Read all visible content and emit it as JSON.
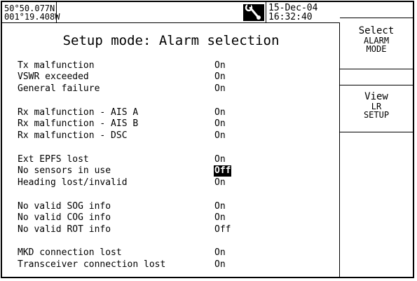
{
  "header": {
    "latitude": "50°50.077N",
    "longitude": "001°19.408W",
    "date": "15-Dec-04",
    "time": "16:32:40",
    "status_icon": "wrench-icon"
  },
  "page": {
    "title": "Setup mode: Alarm selection"
  },
  "alarms": [
    {
      "label": "Tx malfunction",
      "value": "On"
    },
    {
      "label": "VSWR exceeded",
      "value": "On"
    },
    {
      "label": "General failure",
      "value": "On"
    },
    {
      "label": "Rx malfunction - AIS A",
      "value": "On"
    },
    {
      "label": "Rx malfunction - AIS B",
      "value": "On"
    },
    {
      "label": "Rx malfunction - DSC",
      "value": "On"
    },
    {
      "label": "Ext EPFS lost",
      "value": "On"
    },
    {
      "label": "No sensors in use",
      "value": "Off",
      "selected": true
    },
    {
      "label": "Heading lost/invalid",
      "value": "On"
    },
    {
      "label": "No valid SOG info",
      "value": "On"
    },
    {
      "label": "No valid COG info",
      "value": "On"
    },
    {
      "label": "No valid ROT info",
      "value": "Off"
    },
    {
      "label": "MKD connection lost",
      "value": "On"
    },
    {
      "label": "Transceiver connection lost",
      "value": "On"
    }
  ],
  "softkeys": [
    {
      "lines": [
        "Select",
        "ALARM",
        "MODE"
      ]
    },
    {
      "lines": [
        "View",
        "LR",
        "SETUP"
      ]
    }
  ]
}
